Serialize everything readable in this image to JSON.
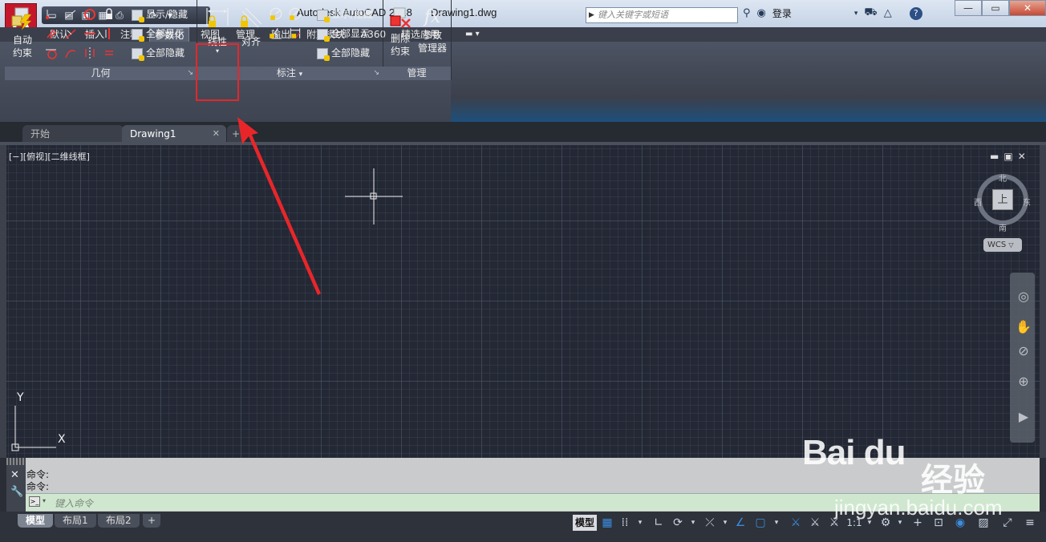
{
  "titlebar": {
    "app_title": "Autodesk AutoCAD 2018",
    "document": "Drawing1.dwg",
    "search_placeholder": "键入关键字或短语",
    "login": "登录"
  },
  "ribbon_tabs": [
    "默认",
    "插入",
    "注释",
    "参数化",
    "视图",
    "管理",
    "输出",
    "附加模块",
    "A360",
    "精选应用"
  ],
  "active_tab": "参数化",
  "geometry_panel": {
    "title": "几何",
    "auto_constrain_line1": "自动",
    "auto_constrain_line2": "约束",
    "show_hide": "显示/隐藏",
    "show_all": "全部显示",
    "hide_all": "全部隐藏"
  },
  "dimension_panel": {
    "title": "标注",
    "linear": "线性",
    "aligned": "对齐",
    "show_hide": "显示/隐藏",
    "show_all": "全部显示",
    "hide_all": "全部隐藏"
  },
  "manage_panel": {
    "title": "管理",
    "delete_line1": "删除",
    "delete_line2": "约束",
    "params_line1": "参数",
    "params_line2": "管理器",
    "fx": "fx"
  },
  "file_tabs": [
    "开始",
    "Drawing1"
  ],
  "viewport": {
    "label": "[−][俯视][二维线框]",
    "viewcube": {
      "top": "上",
      "north": "北",
      "south": "南",
      "east": "东",
      "west": "西"
    },
    "wcs": "WCS"
  },
  "axis": {
    "x": "X",
    "y": "Y"
  },
  "command": {
    "history": [
      "命令:",
      "命令:"
    ],
    "placeholder": "键入命令"
  },
  "layout_tabs": [
    "模型",
    "布局1",
    "布局2"
  ],
  "status": {
    "model": "模型",
    "scale": "1:1"
  },
  "watermark": {
    "brand": "Bai du",
    "cn": "经验",
    "url": "jingyan.baidu.com"
  },
  "colors": {
    "accent_red": "#e8262a",
    "canvas": "#232834",
    "ribbon": "#4d5463",
    "cmd_input": "#cfe7cf"
  }
}
